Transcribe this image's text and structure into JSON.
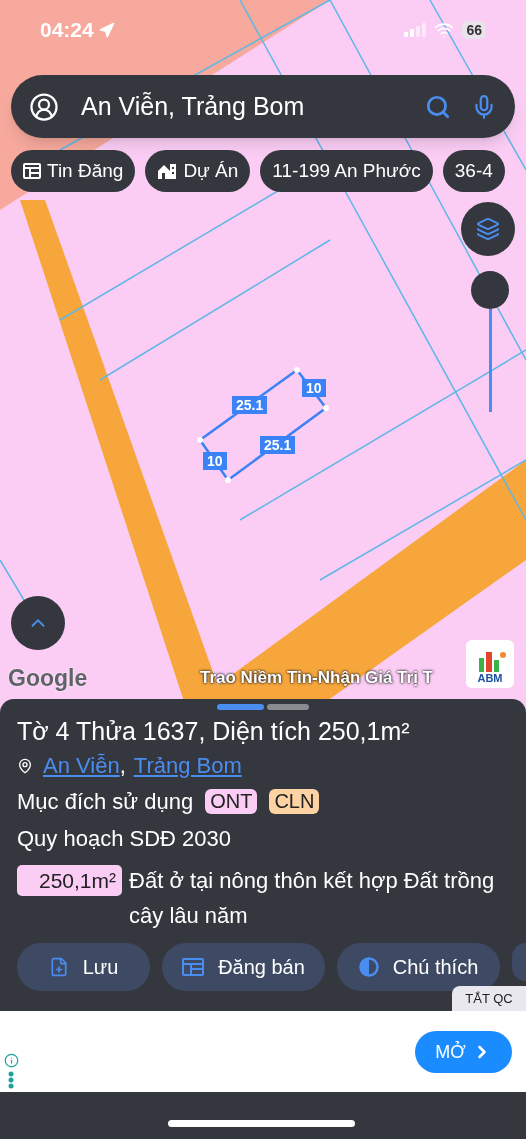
{
  "status_bar": {
    "time": "04:24",
    "battery": "66"
  },
  "search": {
    "value": "An Viễn, Trảng Bom"
  },
  "chips": [
    {
      "label": "Tin Đăng",
      "kind": "listing"
    },
    {
      "label": "Dự Án",
      "kind": "project"
    },
    {
      "label": "11-199 An Phước",
      "kind": "plain"
    },
    {
      "label": "36-4",
      "kind": "plain"
    }
  ],
  "parcel": {
    "length_labels": [
      "25.1",
      "25.1"
    ],
    "width_labels": [
      "10",
      "10"
    ]
  },
  "map_footer": {
    "attribution": "Google",
    "slogan": "Trao Niềm Tin-Nhận Giá Trị T",
    "logo_text": "ABM"
  },
  "sheet": {
    "pager": [
      {
        "selected": true
      },
      {
        "selected": false
      }
    ],
    "title": "Tờ 4 Thửa 1637, Diện tích 250,1m²",
    "location": {
      "links": [
        "An Viễn",
        "Trảng Bom"
      ],
      "separator": ","
    },
    "purpose": {
      "label": "Mục đích sử dụng",
      "tags": [
        {
          "label": "ONT",
          "color": "#fbcdf5"
        },
        {
          "label": "CLN",
          "color": "#fdd3a3"
        }
      ]
    },
    "planning": "Quy hoạch SDĐ 2030",
    "zones": [
      {
        "area": "250,1m²",
        "color": "#fbcdf5",
        "description": "Đất ở tại nông thôn kết hợp Đất trồng cây lâu năm"
      }
    ],
    "actions": [
      {
        "label": "Lưu",
        "kind": "save"
      },
      {
        "label": "Đăng bán",
        "kind": "post"
      },
      {
        "label": "Chú thích",
        "kind": "legend"
      },
      {
        "kind": "more"
      }
    ]
  },
  "ad": {
    "close_label": "TẮT QC",
    "button": "MỞ"
  }
}
